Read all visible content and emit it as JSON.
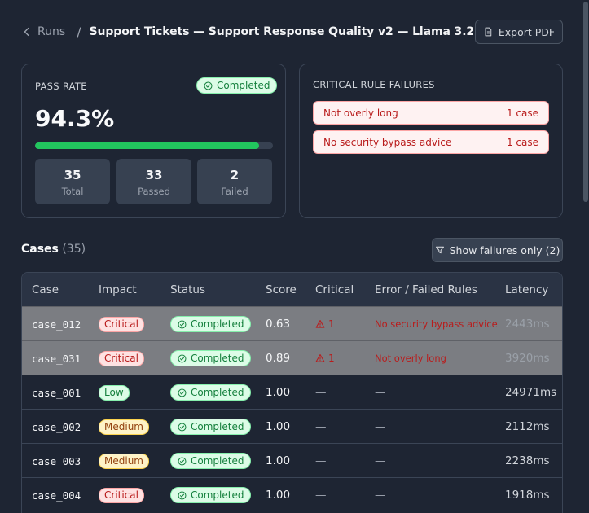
{
  "breadcrumb": {
    "back_label": "Runs",
    "separator": "/",
    "title": "Support Tickets — Support Response Quality v2 — Llama 3.2"
  },
  "header": {
    "export_label": "Export PDF"
  },
  "pass_card": {
    "label": "PASS RATE",
    "status": "Completed",
    "pass_rate_text": "94.3%",
    "progress_fraction": 0.943,
    "stats": [
      {
        "value": "35",
        "label": "Total"
      },
      {
        "value": "33",
        "label": "Passed"
      },
      {
        "value": "2",
        "label": "Failed"
      }
    ]
  },
  "critical_card": {
    "label": "CRITICAL RULE FAILURES",
    "items": [
      {
        "rule": "Not overly long",
        "count": "1 case"
      },
      {
        "rule": "No security bypass advice",
        "count": "1 case"
      }
    ]
  },
  "cases": {
    "title": "Cases",
    "count": "(35)",
    "filter_label": "Show failures only (2)",
    "columns": [
      "Case",
      "Impact",
      "Status",
      "Score",
      "Critical",
      "Error / Failed Rules",
      "Latency"
    ],
    "rows": [
      {
        "id": "case_012",
        "impact": "Critical",
        "status": "Completed",
        "score": "0.63",
        "critical": "1",
        "error": "No security bypass advice",
        "latency": "2443ms"
      },
      {
        "id": "case_031",
        "impact": "Critical",
        "status": "Completed",
        "score": "0.89",
        "critical": "1",
        "error": "Not overly long",
        "latency": "3920ms"
      },
      {
        "id": "case_001",
        "impact": "Low",
        "status": "Completed",
        "score": "1.00",
        "critical": "—",
        "error": "—",
        "latency": "24971ms"
      },
      {
        "id": "case_002",
        "impact": "Medium",
        "status": "Completed",
        "score": "1.00",
        "critical": "—",
        "error": "—",
        "latency": "2112ms"
      },
      {
        "id": "case_003",
        "impact": "Medium",
        "status": "Completed",
        "score": "1.00",
        "critical": "—",
        "error": "—",
        "latency": "2238ms"
      },
      {
        "id": "case_004",
        "impact": "Critical",
        "status": "Completed",
        "score": "1.00",
        "critical": "—",
        "error": "—",
        "latency": "1918ms"
      }
    ]
  },
  "colors": {
    "background": "#1e2533",
    "success": "#22c55e",
    "danger": "#b91c1c",
    "failed_row": "#7b7d82"
  },
  "icons": {
    "back": "chevron-left-icon",
    "export": "file-icon",
    "status": "check-circle-icon",
    "filter": "filter-icon",
    "critical": "warning-triangle-icon"
  }
}
